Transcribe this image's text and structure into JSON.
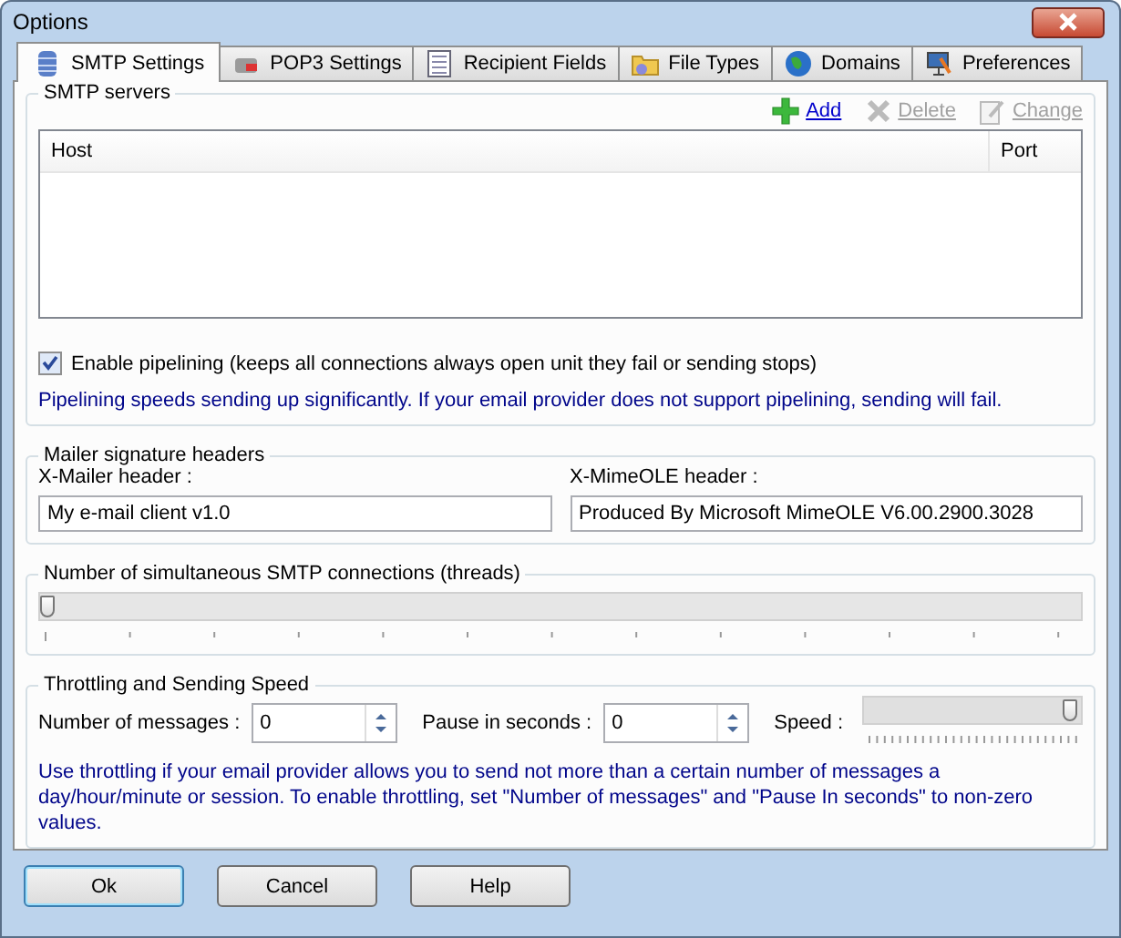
{
  "window": {
    "title": "Options"
  },
  "tabs": [
    {
      "label": "SMTP Settings",
      "selected": true
    },
    {
      "label": "POP3 Settings",
      "selected": false
    },
    {
      "label": "Recipient Fields",
      "selected": false
    },
    {
      "label": "File Types",
      "selected": false
    },
    {
      "label": "Domains",
      "selected": false
    },
    {
      "label": "Preferences",
      "selected": false
    }
  ],
  "smtp_servers": {
    "title": "SMTP servers",
    "actions": [
      {
        "label": "Add",
        "kind": "add",
        "disabled": false
      },
      {
        "label": "Delete",
        "kind": "delete",
        "disabled": true
      },
      {
        "label": "Change",
        "kind": "change",
        "disabled": true
      }
    ],
    "columns": [
      "Host",
      "Port"
    ],
    "pipelining": {
      "label": "Enable pipelining (keeps all connections always open unit they fail or sending stops)",
      "checked": true
    },
    "note": "Pipelining speeds sending up significantly. If your email provider does not support pipelining, sending will fail."
  },
  "mailer_headers": {
    "title": "Mailer signature headers",
    "fields": [
      {
        "label": "X-Mailer header :",
        "value": "My e-mail client v1.0"
      },
      {
        "label": "X-MimeOLE header :",
        "value": "Produced By Microsoft MimeOLE V6.00.2900.3028"
      }
    ]
  },
  "threads": {
    "title": "Number of simultaneous SMTP connections (threads)",
    "level": 0
  },
  "throttling": {
    "title": "Throttling and Sending Speed",
    "messages": {
      "label": "Number of messages :",
      "value": "0"
    },
    "pause": {
      "label": "Pause in seconds :",
      "value": "0"
    },
    "speed": {
      "label": "Speed :",
      "level": 1
    },
    "note": "Use throttling if your email provider allows you to send not more than a certain number of messages a day/hour/minute or session. To enable throttling, set \"Number of messages\" and \"Pause In seconds\" to non-zero values."
  },
  "buttons": [
    {
      "label": "Ok",
      "selected": true
    },
    {
      "label": "Cancel",
      "selected": false
    },
    {
      "label": "Help",
      "selected": false
    }
  ]
}
